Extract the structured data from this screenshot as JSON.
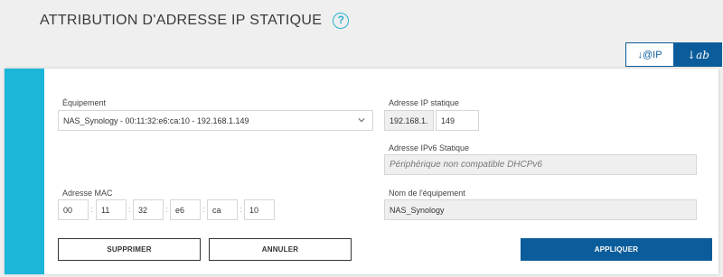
{
  "header": {
    "title": "ATTRIBUTION D'ADRESSE IP STATIQUE",
    "help_icon": "?"
  },
  "sort": {
    "by_ip_label": "↓@IP",
    "by_name_label": "↓ab"
  },
  "form": {
    "device": {
      "label": "Équipement",
      "value": "NAS_Synology - 00:11:32:e6:ca:10 - 192.168.1.149"
    },
    "static_ip": {
      "label": "Adresse IP statique",
      "prefix": "192.168.1.",
      "suffix": "149"
    },
    "ipv6": {
      "label": "Adresse IPv6 Statique",
      "value": "Périphérique non compatible DHCPv6"
    },
    "mac": {
      "label": "Adresse MAC",
      "separator": ":",
      "octets": [
        "00",
        "11",
        "32",
        "e6",
        "ca",
        "10"
      ]
    },
    "device_name": {
      "label": "Nom de l'équipement",
      "value": "NAS_Synology"
    }
  },
  "actions": {
    "delete_label": "SUPPRIMER",
    "cancel_label": "ANNULER",
    "apply_label": "APPLIQUER"
  },
  "colors": {
    "accent": "#1cb6d9",
    "primary": "#0b5c9a",
    "background": "#efefef"
  }
}
